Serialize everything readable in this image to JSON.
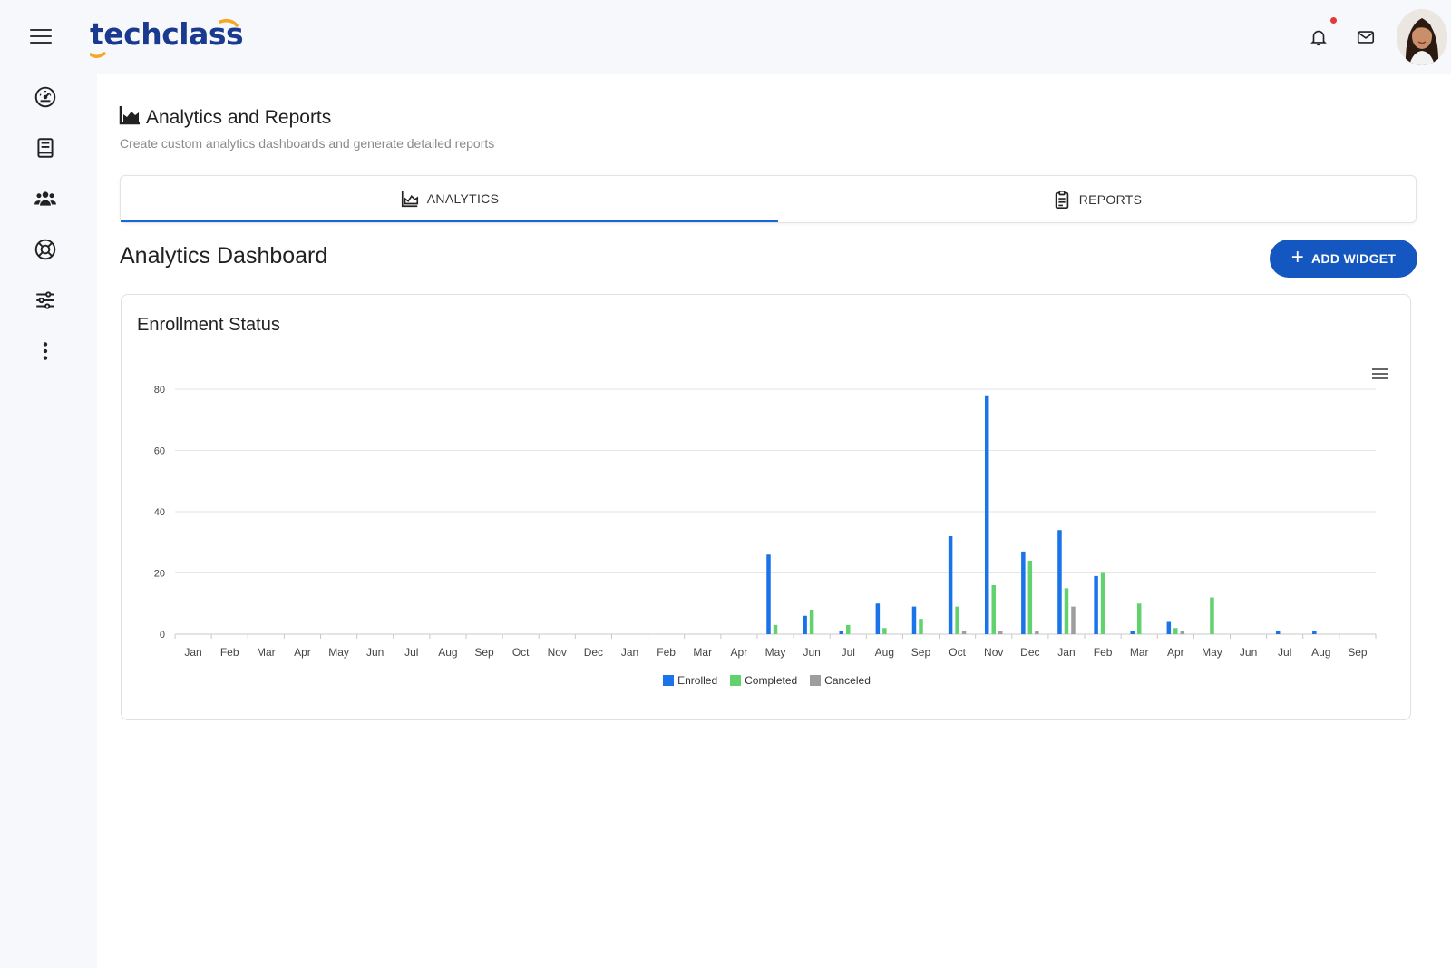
{
  "brand": {
    "name": "techclass"
  },
  "colors": {
    "accent": "#1967d2",
    "button": "#1557c0",
    "enrolled": "#1a73e8",
    "completed": "#62d26f",
    "canceled": "#9e9e9e",
    "notification_dot": "#e53935"
  },
  "sidebar": {
    "items": [
      {
        "icon": "dashboard-gauge-icon"
      },
      {
        "icon": "book-icon"
      },
      {
        "icon": "users-group-icon"
      },
      {
        "icon": "lifebuoy-icon"
      },
      {
        "icon": "sliders-icon"
      },
      {
        "icon": "more-vertical-icon"
      }
    ]
  },
  "header": {
    "title": "Analytics and Reports",
    "subtitle": "Create custom analytics dashboards and generate detailed reports"
  },
  "tabs": [
    {
      "label": "ANALYTICS",
      "icon": "area-chart-icon",
      "active": true
    },
    {
      "label": "REPORTS",
      "icon": "clipboard-icon",
      "active": false
    }
  ],
  "dashboard": {
    "title": "Analytics Dashboard",
    "add_widget_label": "ADD WIDGET"
  },
  "widget": {
    "title": "Enrollment Status"
  },
  "chart_data": {
    "type": "bar",
    "categories": [
      "Jan",
      "Feb",
      "Mar",
      "Apr",
      "May",
      "Jun",
      "Jul",
      "Aug",
      "Sep",
      "Oct",
      "Nov",
      "Dec",
      "Jan",
      "Feb",
      "Mar",
      "Apr",
      "May",
      "Jun",
      "Jul",
      "Aug",
      "Sep",
      "Oct",
      "Nov",
      "Dec",
      "Jan",
      "Feb",
      "Mar",
      "Apr",
      "May",
      "Jun",
      "Jul",
      "Aug",
      "Sep"
    ],
    "series": [
      {
        "name": "Enrolled",
        "color": "#1a73e8",
        "values": [
          0,
          0,
          0,
          0,
          0,
          0,
          0,
          0,
          0,
          0,
          0,
          0,
          0,
          0,
          0,
          0,
          26,
          6,
          1,
          10,
          9,
          32,
          78,
          27,
          34,
          19,
          1,
          4,
          0,
          0,
          1,
          1,
          0
        ]
      },
      {
        "name": "Completed",
        "color": "#62d26f",
        "values": [
          0,
          0,
          0,
          0,
          0,
          0,
          0,
          0,
          0,
          0,
          0,
          0,
          0,
          0,
          0,
          0,
          3,
          8,
          3,
          2,
          5,
          9,
          16,
          24,
          15,
          20,
          10,
          2,
          12,
          0,
          0,
          0,
          0
        ]
      },
      {
        "name": "Canceled",
        "color": "#9e9e9e",
        "values": [
          0,
          0,
          0,
          0,
          0,
          0,
          0,
          0,
          0,
          0,
          0,
          0,
          0,
          0,
          0,
          0,
          0,
          0,
          0,
          0,
          0,
          1,
          1,
          1,
          9,
          0,
          0,
          1,
          0,
          0,
          0,
          0,
          0
        ]
      }
    ],
    "yticks": [
      0,
      20,
      40,
      60,
      80
    ],
    "ylim": [
      0,
      80
    ],
    "grid": true,
    "legend_position": "bottom-center"
  }
}
